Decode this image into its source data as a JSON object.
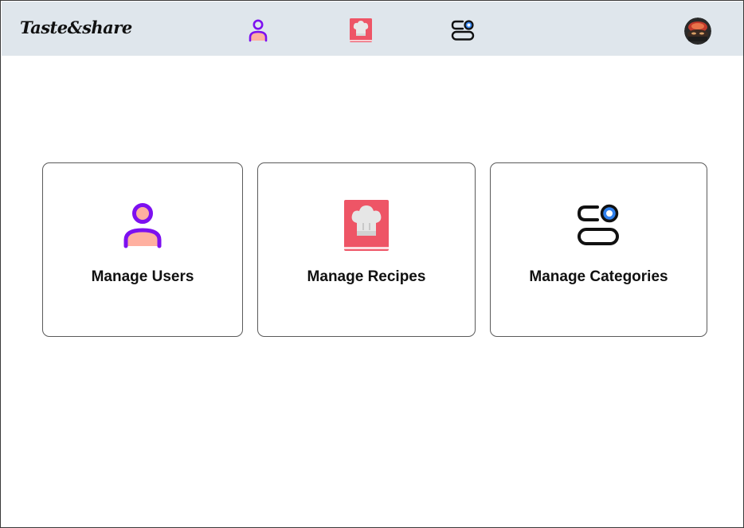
{
  "app": {
    "brand": "Taste&share"
  },
  "nav": {
    "items": [
      {
        "icon": "user-icon"
      },
      {
        "icon": "recipe-book-icon"
      },
      {
        "icon": "categories-icon"
      }
    ],
    "avatar": "avatar"
  },
  "cards": [
    {
      "label": "Manage Users",
      "icon": "user-icon"
    },
    {
      "label": "Manage Recipes",
      "icon": "recipe-book-icon"
    },
    {
      "label": "Manage Categories",
      "icon": "categories-icon"
    }
  ],
  "colors": {
    "navbar_bg": "#dfe6ec",
    "user_purple": "#7d10f0",
    "user_peach": "#ffb0a0",
    "recipe_red": "#ee5566",
    "category_blue": "#2f80ed"
  }
}
